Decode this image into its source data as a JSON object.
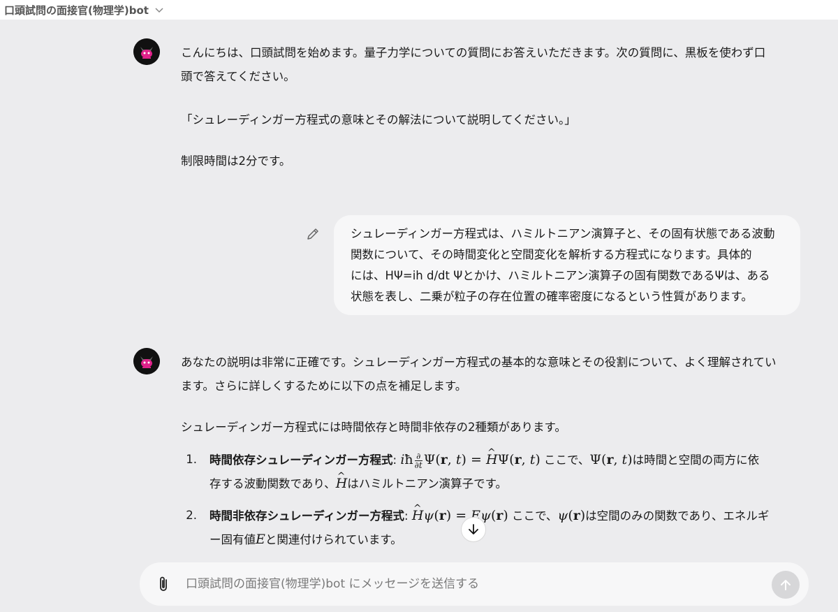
{
  "header": {
    "title": "口頭試問の面接官(物理学)bot"
  },
  "messages": {
    "bot1": {
      "line1": "こんにちは、口頭試問を始めます。量子力学についての質問にお答えいただきます。次の質問に、黒板を使わず口",
      "line2": "頭で答えてください。",
      "question": "「シュレーディンガー方程式の意味とその解法について説明してください。」",
      "time_limit": "制限時間は2分です。"
    },
    "user": {
      "line1": "シュレーディンガー方程式は、ハミルトニアン演算子と、その固有状態である波動",
      "line2": "関数について、その時間変化と空間変化を解析する方程式になります。具体的",
      "line3": "には、HΨ=ih d/dt Ψとかけ、ハミルトニアン演算子の固有関数であるΨは、ある",
      "line4": "状態を表し、二乗が粒子の存在位置の確率密度になるという性質があります。"
    },
    "bot2": {
      "line1": "あなたの説明は非常に正確です。シュレーディンガー方程式の基本的な意味とその役割について、よく理解されてい",
      "line2": "ます。さらに詳しくするために以下の点を補足します。",
      "intro": "シュレーディンガー方程式には時間依存と時間非依存の2種類があります。",
      "items": [
        {
          "num": "1.",
          "title": "時間依存シュレーディンガー方程式",
          "text_a": "ここで、",
          "text_b": "は時間と空間の両方に依",
          "line2_a": "存する波動関数であり、",
          "line2_b": "はハミルトニアン演算子です。"
        },
        {
          "num": "2.",
          "title": "時間非依存シュレーディンガー方程式",
          "text_a": "ここで、",
          "text_b": "は空間のみの関数であり、エネルギ",
          "line2_a": "ー固有値",
          "line2_b": "と関連付けられています。"
        }
      ]
    }
  },
  "composer": {
    "placeholder": "口頭試問の面接官(物理学)bot にメッセージを送信する"
  },
  "colors": {
    "background": "#ececee",
    "bubble": "#f7f7f8",
    "avatar_accent": "#e0218a"
  },
  "icons": [
    "chevron-down-icon",
    "bot-avatar-icon",
    "edit-pencil-icon",
    "arrow-down-icon",
    "paperclip-icon",
    "arrow-up-icon"
  ]
}
